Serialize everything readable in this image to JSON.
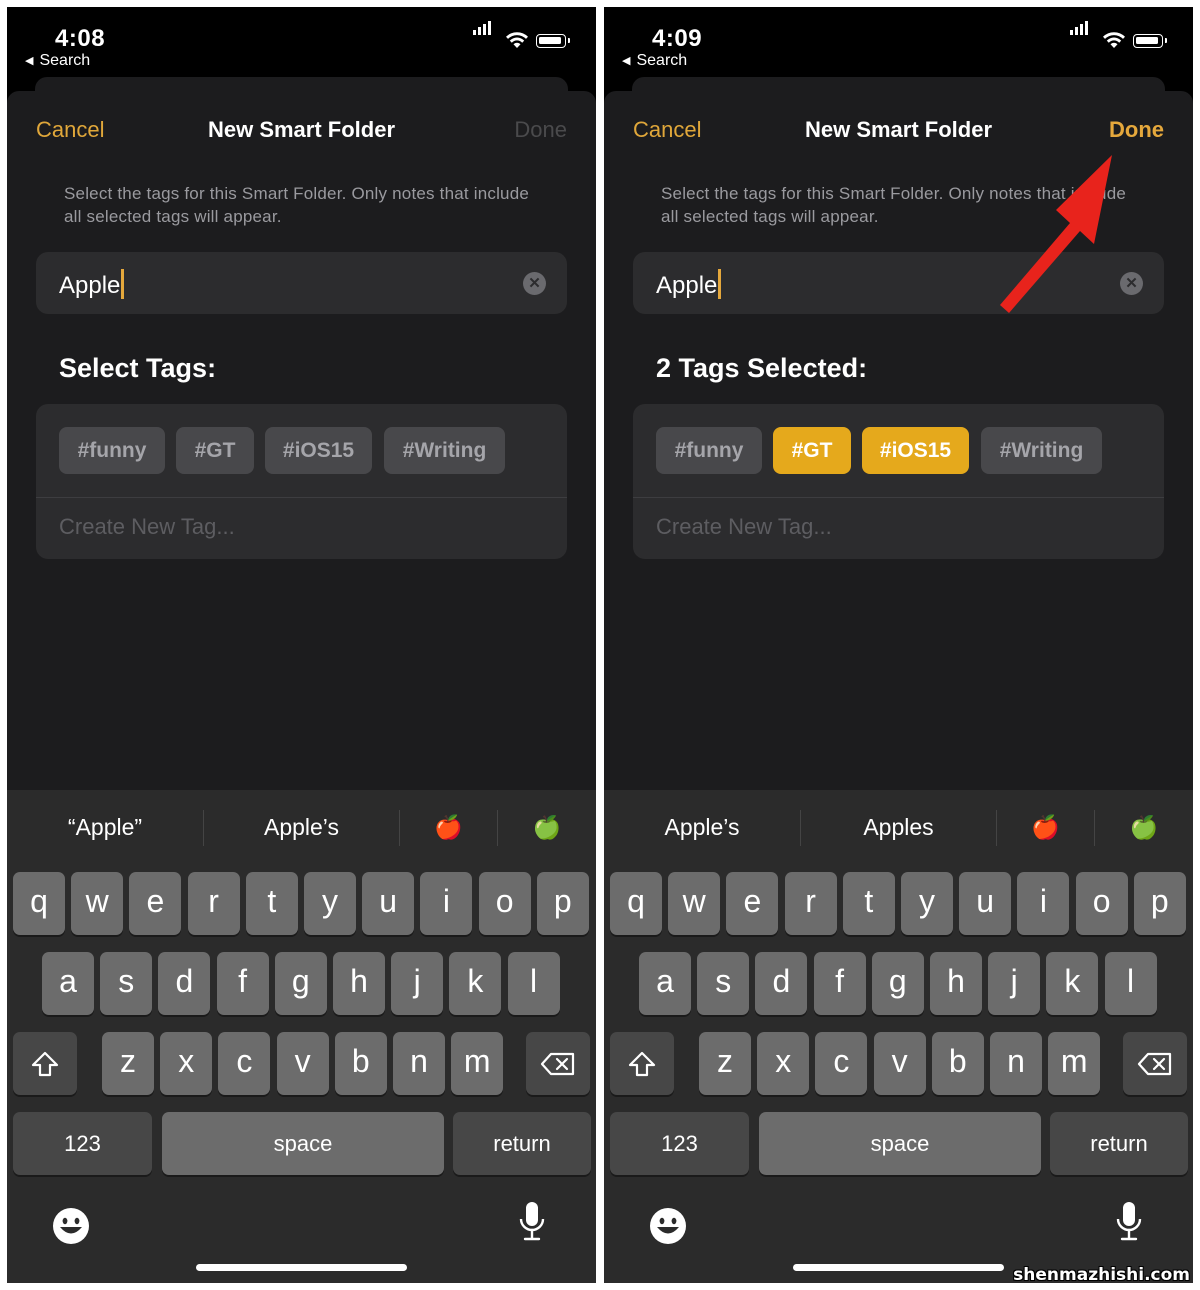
{
  "screens": [
    {
      "status": {
        "time": "4:08",
        "back_label": "Search"
      },
      "nav": {
        "cancel": "Cancel",
        "title": "New Smart Folder",
        "done": "Done",
        "done_active": false
      },
      "description": "Select the tags for this Smart Folder. Only notes that include all selected tags will appear.",
      "search": {
        "value": "Apple"
      },
      "section_heading": "Select Tags:",
      "tags": [
        {
          "label": "#funny",
          "selected": false
        },
        {
          "label": "#GT",
          "selected": false
        },
        {
          "label": "#iOS15",
          "selected": false
        },
        {
          "label": "#Writing",
          "selected": false
        }
      ],
      "create_tag_placeholder": "Create New Tag...",
      "suggestions": [
        "“Apple”",
        "Apple’s",
        "🍎",
        "🍏"
      ]
    },
    {
      "status": {
        "time": "4:09",
        "back_label": "Search"
      },
      "nav": {
        "cancel": "Cancel",
        "title": "New Smart Folder",
        "done": "Done",
        "done_active": true
      },
      "description": "Select the tags for this Smart Folder. Only notes that include all selected tags will appear.",
      "search": {
        "value": "Apple"
      },
      "section_heading": "2 Tags Selected:",
      "tags": [
        {
          "label": "#funny",
          "selected": false
        },
        {
          "label": "#GT",
          "selected": true
        },
        {
          "label": "#iOS15",
          "selected": true
        },
        {
          "label": "#Writing",
          "selected": false
        }
      ],
      "create_tag_placeholder": "Create New Tag...",
      "suggestions": [
        "Apple’s",
        "Apples",
        "🍎",
        "🍏"
      ]
    }
  ],
  "keyboard": {
    "rows": [
      [
        "q",
        "w",
        "e",
        "r",
        "t",
        "y",
        "u",
        "i",
        "o",
        "p"
      ],
      [
        "a",
        "s",
        "d",
        "f",
        "g",
        "h",
        "j",
        "k",
        "l"
      ],
      [
        "z",
        "x",
        "c",
        "v",
        "b",
        "n",
        "m"
      ]
    ],
    "numbers_key": "123",
    "space_key": "space",
    "return_key": "return"
  },
  "icons": {
    "shift": "shift-icon",
    "delete": "delete-icon",
    "emoji": "emoji-icon",
    "mic": "microphone-icon",
    "clear": "clear-icon",
    "arrow": "red-arrow-annotation"
  },
  "colors": {
    "accent": "#e5a83c",
    "tag_selected": "#e5a91c",
    "sheet": "#1c1c1e",
    "field": "#2c2c2e",
    "keyboard": "#2b2b2b",
    "key": "#6c6c6c",
    "key_dark": "#474747",
    "arrow": "#e8231c"
  },
  "watermark": "shenmazhishi.com"
}
